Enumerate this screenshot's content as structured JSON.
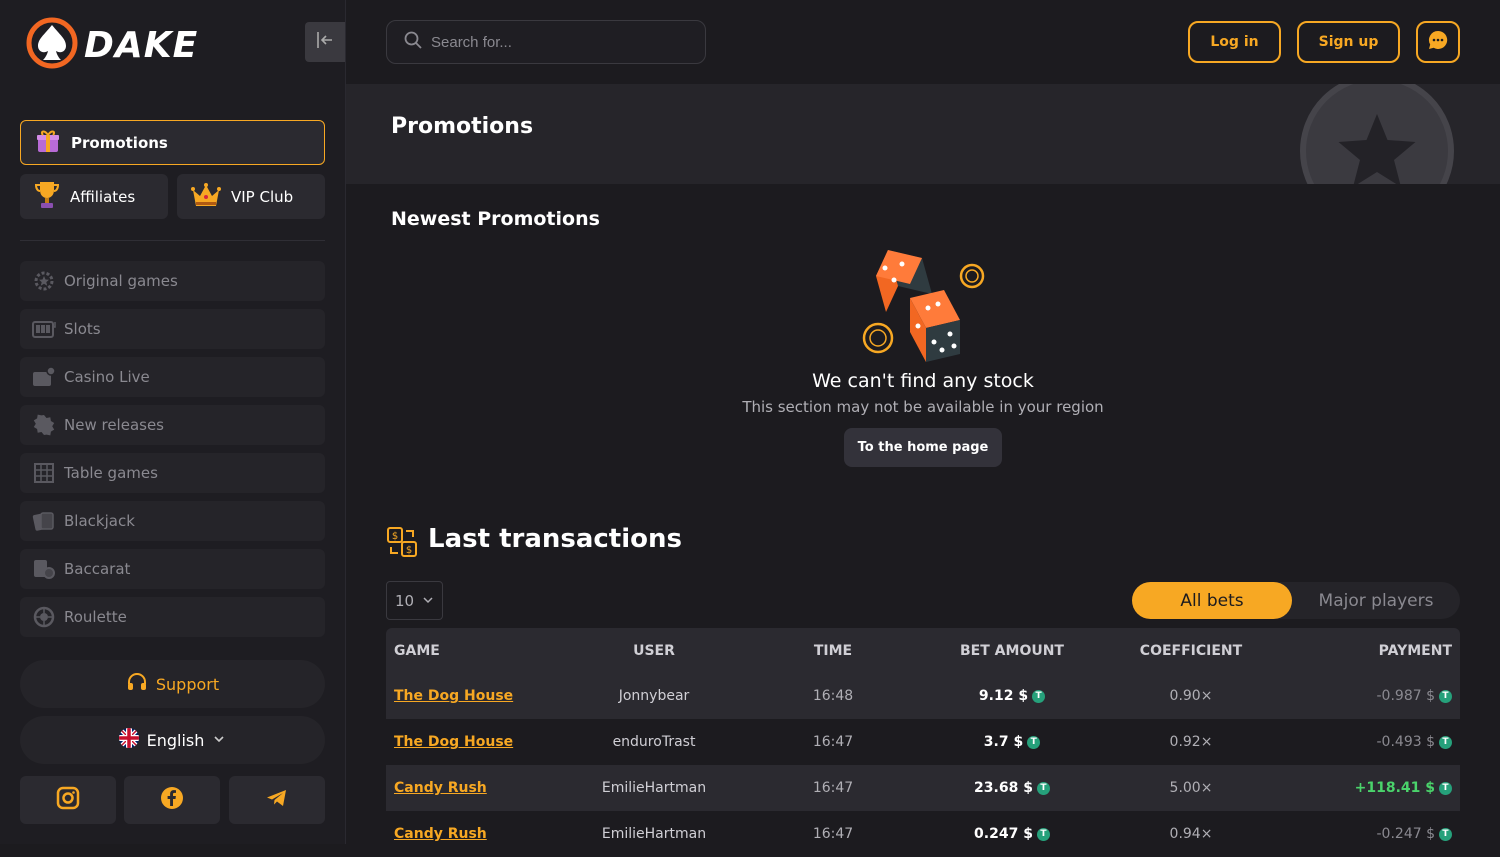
{
  "brand": {
    "name": "DAKE"
  },
  "sidebar": {
    "promotions": "Promotions",
    "affiliates": "Affiliates",
    "vip": "VIP Club",
    "nav": [
      "Original games",
      "Slots",
      "Casino Live",
      "New releases",
      "Table games",
      "Blackjack",
      "Baccarat",
      "Roulette"
    ],
    "support": "Support",
    "language": "English"
  },
  "topbar": {
    "search_placeholder": "Search for...",
    "login": "Log in",
    "signup": "Sign up"
  },
  "page": {
    "title": "Promotions",
    "section_title": "Newest Promotions",
    "empty_title": "We can't find any stock",
    "empty_sub": "This section may not be available in your region",
    "home_button": "To the home page"
  },
  "transactions": {
    "title": "Last transactions",
    "page_size": "10",
    "tab_all": "All bets",
    "tab_major": "Major players",
    "headers": [
      "GAME",
      "USER",
      "TIME",
      "BET AMOUNT",
      "COEFFICIENT",
      "PAYMENT"
    ],
    "rows": [
      {
        "game": "The Dog House",
        "user": "Jonnybear",
        "time": "16:48",
        "bet": "9.12 $",
        "coef": "0.90×",
        "pay": "-0.987 $"
      },
      {
        "game": "The Dog House",
        "user": "enduroTrast",
        "time": "16:47",
        "bet": "3.7 $",
        "coef": "0.92×",
        "pay": "-0.493 $"
      },
      {
        "game": "Candy Rush",
        "user": "EmilieHartman",
        "time": "16:47",
        "bet": "23.68 $",
        "coef": "5.00×",
        "pay": "+118.41 $"
      },
      {
        "game": "Candy Rush",
        "user": "EmilieHartman",
        "time": "16:47",
        "bet": "0.247 $",
        "coef": "0.94×",
        "pay": "-0.247 $"
      }
    ]
  },
  "colors": {
    "accent": "#f7a823",
    "positive": "#4ad36b",
    "tether": "#26a17b"
  },
  "icons": [
    "spade-logo-icon",
    "collapse-icon",
    "gift-icon",
    "trophy-icon",
    "crown-icon",
    "search-icon",
    "chat-icon",
    "dice-icon",
    "headphones-icon",
    "uk-flag-icon",
    "chevron-down-icon",
    "instagram-icon",
    "facebook-icon",
    "telegram-icon",
    "exchange-icon",
    "tether-icon",
    "star-coin-icon"
  ]
}
